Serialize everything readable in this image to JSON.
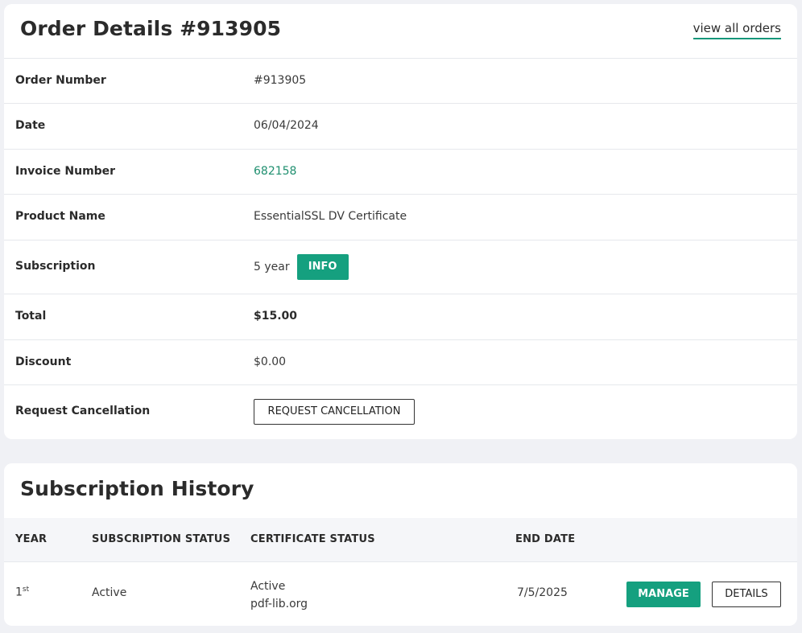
{
  "order": {
    "title": "Order Details #913905",
    "view_all_label": "view all orders",
    "rows": [
      {
        "label": "Order Number",
        "value": "#913905"
      },
      {
        "label": "Date",
        "value": "06/04/2024"
      },
      {
        "label": "Invoice Number",
        "value": "682158"
      },
      {
        "label": "Product Name",
        "value": "EssentialSSL DV Certificate"
      },
      {
        "label": "Subscription",
        "value": "5 year",
        "button": "INFO"
      },
      {
        "label": "Total",
        "value": "$15.00"
      },
      {
        "label": "Discount",
        "value": "$0.00"
      },
      {
        "label": "Request Cancellation",
        "button": "REQUEST CANCELLATION"
      }
    ]
  },
  "history": {
    "title": "Subscription History",
    "columns": [
      "YEAR",
      "SUBSCRIPTION STATUS",
      "CERTIFICATE STATUS",
      "END DATE"
    ],
    "rows": [
      {
        "year": "1",
        "year_suffix": "st",
        "subscription_status": "Active",
        "certificate_status": "Active",
        "domain": "pdf-lib.org",
        "end_date": "7/5/2025",
        "manage_label": "MANAGE",
        "details_label": "DETAILS"
      }
    ]
  },
  "colors": {
    "accent": "#15a07f",
    "link": "#1f8f6f",
    "page_background": "#f0f1f5"
  }
}
